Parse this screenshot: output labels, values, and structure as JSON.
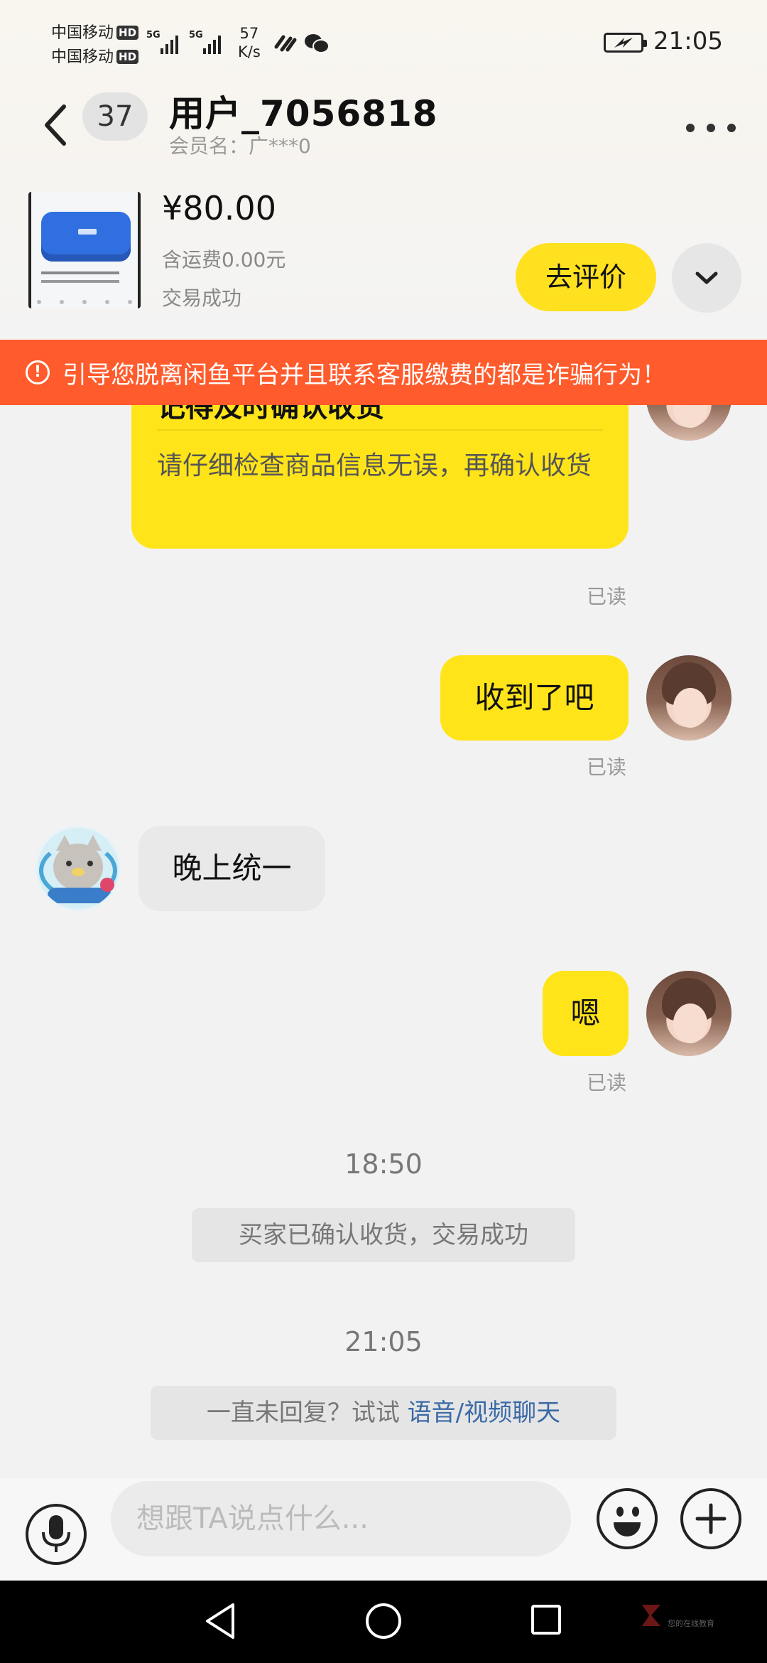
{
  "status_bar": {
    "carrier_1": "中国移动",
    "carrier_2": "中国移动",
    "hd": "HD",
    "network_1": "5G",
    "network_2": "5G",
    "speed_value": "57",
    "speed_unit": "K/s",
    "time": "21:05"
  },
  "header": {
    "unread_count": "37",
    "title": "用户_7056818",
    "member_name": "会员名：广***0"
  },
  "product": {
    "price": "¥80.00",
    "shipping": "含运费0.00元",
    "status": "交易成功",
    "review_button": "去评价"
  },
  "warning": {
    "text": "引导您脱离闲鱼平台并且联系客服缴费的都是诈骗行为！"
  },
  "chat": {
    "card": {
      "title": "记得及时确认收货",
      "description": "请仔细检查商品信息无误，再确认收货",
      "read_label": "已读"
    },
    "messages": [
      {
        "text": "收到了吧",
        "read_label": "已读"
      },
      {
        "text": "晚上统一"
      },
      {
        "text": "嗯",
        "read_label": "已读"
      }
    ],
    "separators": [
      {
        "time": "18:50",
        "system_text": "买家已确认收货，交易成功"
      },
      {
        "time": "21:05",
        "system_prefix": "一直未回复？试试 ",
        "system_link": "语音/视频聊天"
      }
    ]
  },
  "input": {
    "placeholder": "想跟TA说点什么..."
  },
  "watermark": {
    "text": "您的在线教育"
  },
  "colors": {
    "accent_yellow": "#ffe41a",
    "warning_orange": "#ff5b2c",
    "link_blue": "#3a6aa6"
  }
}
